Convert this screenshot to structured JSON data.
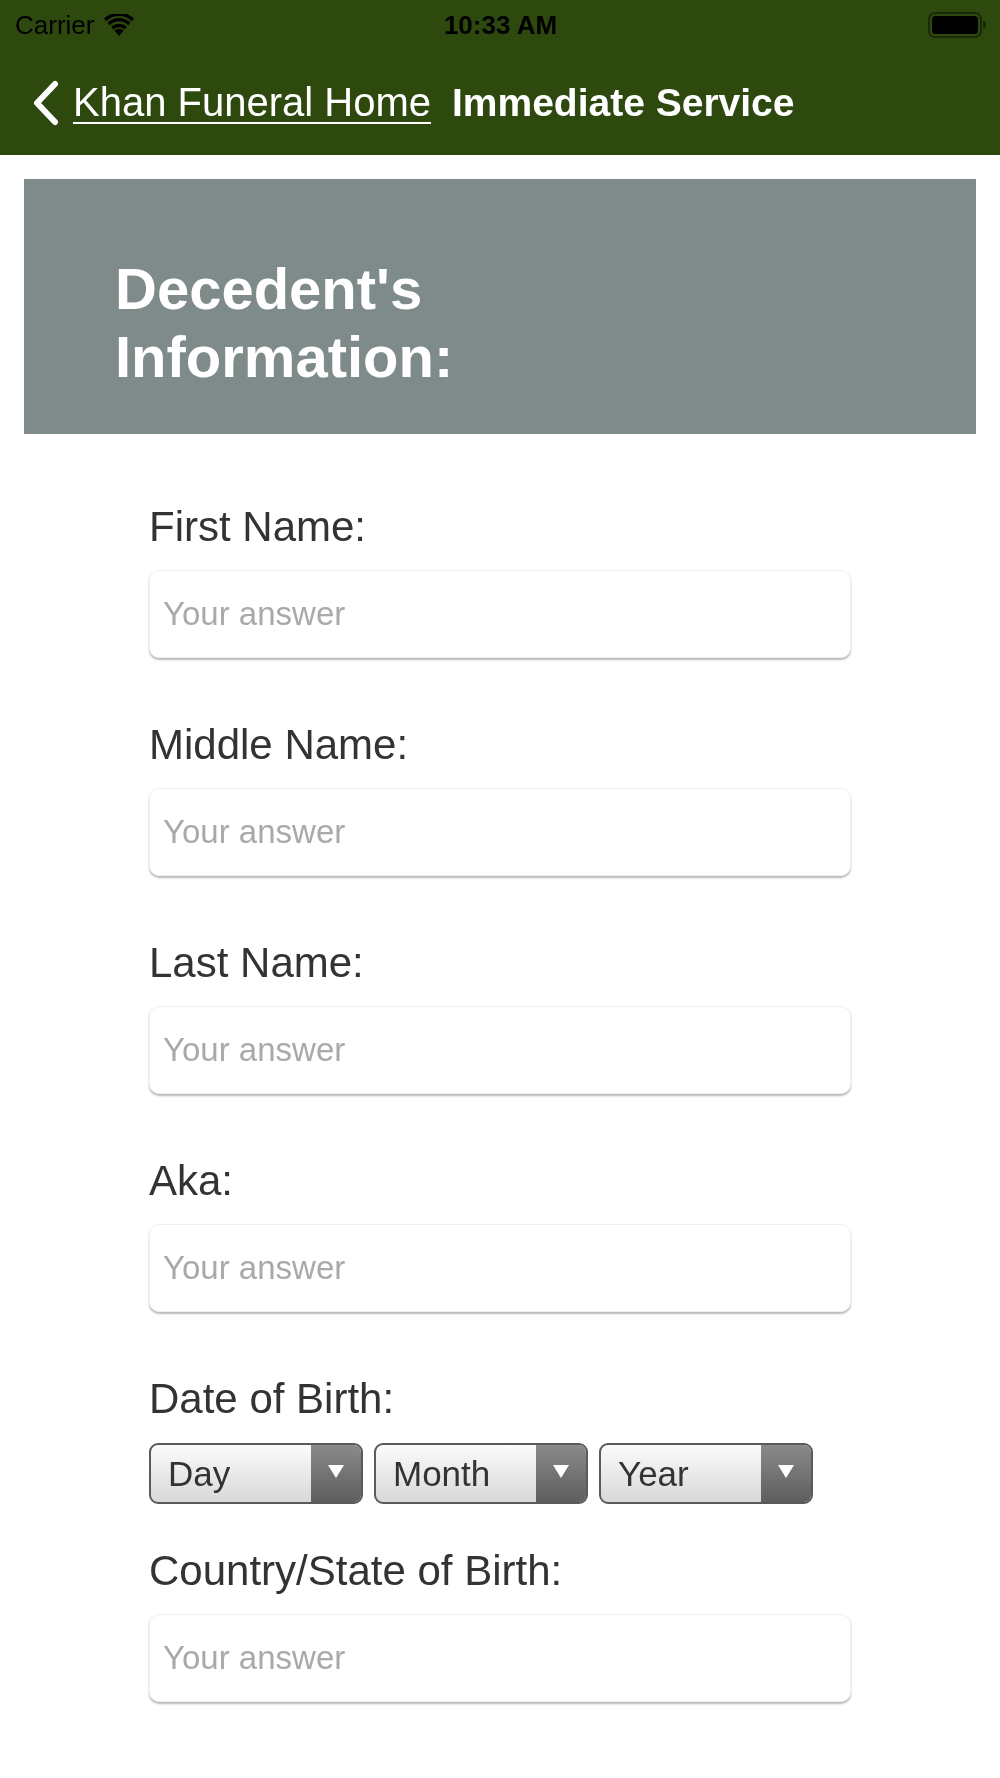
{
  "status_bar": {
    "carrier": "Carrier",
    "time": "10:33 AM"
  },
  "nav_bar": {
    "back_label": "Khan Funeral Home",
    "title": "Immediate Service"
  },
  "section": {
    "title": "Decedent's Information:"
  },
  "fields": [
    {
      "kind": "text",
      "label": "First Name:",
      "placeholder": "Your answer"
    },
    {
      "kind": "text",
      "label": "Middle Name:",
      "placeholder": "Your answer"
    },
    {
      "kind": "text",
      "label": "Last Name:",
      "placeholder": "Your answer"
    },
    {
      "kind": "text",
      "label": "Aka:",
      "placeholder": "Your answer"
    },
    {
      "kind": "date",
      "label": "Date of Birth:",
      "selects": [
        "Day",
        "Month",
        "Year"
      ]
    },
    {
      "kind": "text",
      "label": "Country/State of Birth:",
      "placeholder": "Your answer"
    }
  ]
}
